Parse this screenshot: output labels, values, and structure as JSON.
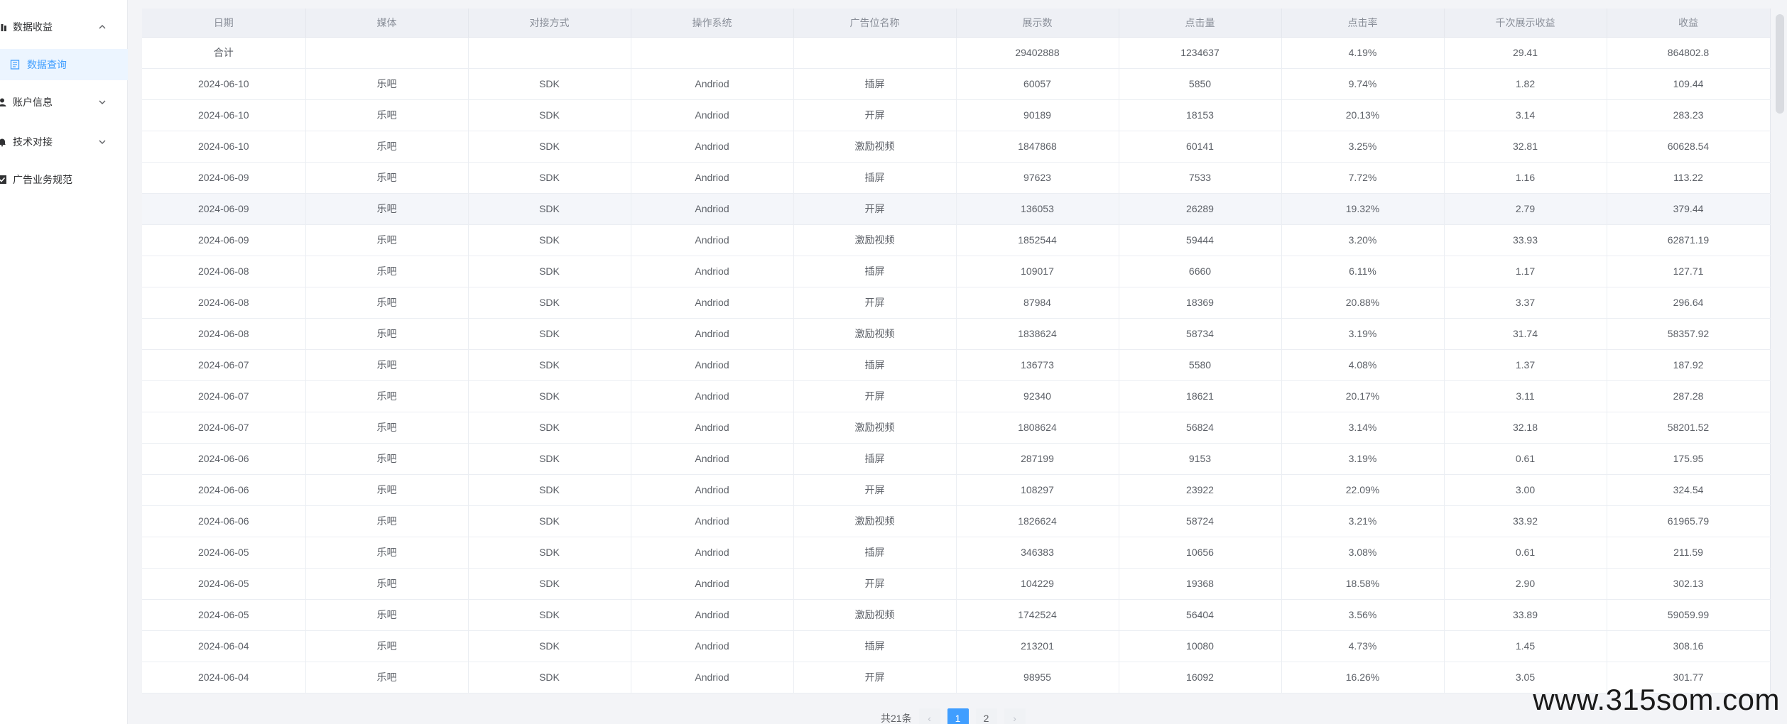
{
  "sidebar": {
    "groups": [
      {
        "label": "数据收益",
        "icon": "chart-icon",
        "expanded": true
      },
      {
        "label": "账户信息",
        "icon": "user-icon",
        "expanded": false
      },
      {
        "label": "技术对接",
        "icon": "bell-icon",
        "expanded": false
      },
      {
        "label": "广告业务规范",
        "icon": "check-square-icon"
      }
    ],
    "active_sub": {
      "label": "数据查询",
      "icon": "document-icon"
    }
  },
  "table": {
    "columns": [
      "日期",
      "媒体",
      "对接方式",
      "操作系统",
      "广告位名称",
      "展示数",
      "点击量",
      "点击率",
      "千次展示收益",
      "收益"
    ],
    "total": [
      "合计",
      "",
      "",
      "",
      "",
      "29402888",
      "1234637",
      "4.19%",
      "29.41",
      "864802.8"
    ],
    "rows": [
      [
        "2024-06-10",
        "乐吧",
        "SDK",
        "Andriod",
        "插屏",
        "60057",
        "5850",
        "9.74%",
        "1.82",
        "109.44"
      ],
      [
        "2024-06-10",
        "乐吧",
        "SDK",
        "Andriod",
        "开屏",
        "90189",
        "18153",
        "20.13%",
        "3.14",
        "283.23"
      ],
      [
        "2024-06-10",
        "乐吧",
        "SDK",
        "Andriod",
        "激励视频",
        "1847868",
        "60141",
        "3.25%",
        "32.81",
        "60628.54"
      ],
      [
        "2024-06-09",
        "乐吧",
        "SDK",
        "Andriod",
        "插屏",
        "97623",
        "7533",
        "7.72%",
        "1.16",
        "113.22"
      ],
      [
        "2024-06-09",
        "乐吧",
        "SDK",
        "Andriod",
        "开屏",
        "136053",
        "26289",
        "19.32%",
        "2.79",
        "379.44"
      ],
      [
        "2024-06-09",
        "乐吧",
        "SDK",
        "Andriod",
        "激励视频",
        "1852544",
        "59444",
        "3.20%",
        "33.93",
        "62871.19"
      ],
      [
        "2024-06-08",
        "乐吧",
        "SDK",
        "Andriod",
        "插屏",
        "109017",
        "6660",
        "6.11%",
        "1.17",
        "127.71"
      ],
      [
        "2024-06-08",
        "乐吧",
        "SDK",
        "Andriod",
        "开屏",
        "87984",
        "18369",
        "20.88%",
        "3.37",
        "296.64"
      ],
      [
        "2024-06-08",
        "乐吧",
        "SDK",
        "Andriod",
        "激励视频",
        "1838624",
        "58734",
        "3.19%",
        "31.74",
        "58357.92"
      ],
      [
        "2024-06-07",
        "乐吧",
        "SDK",
        "Andriod",
        "插屏",
        "136773",
        "5580",
        "4.08%",
        "1.37",
        "187.92"
      ],
      [
        "2024-06-07",
        "乐吧",
        "SDK",
        "Andriod",
        "开屏",
        "92340",
        "18621",
        "20.17%",
        "3.11",
        "287.28"
      ],
      [
        "2024-06-07",
        "乐吧",
        "SDK",
        "Andriod",
        "激励视频",
        "1808624",
        "56824",
        "3.14%",
        "32.18",
        "58201.52"
      ],
      [
        "2024-06-06",
        "乐吧",
        "SDK",
        "Andriod",
        "插屏",
        "287199",
        "9153",
        "3.19%",
        "0.61",
        "175.95"
      ],
      [
        "2024-06-06",
        "乐吧",
        "SDK",
        "Andriod",
        "开屏",
        "108297",
        "23922",
        "22.09%",
        "3.00",
        "324.54"
      ],
      [
        "2024-06-06",
        "乐吧",
        "SDK",
        "Andriod",
        "激励视频",
        "1826624",
        "58724",
        "3.21%",
        "33.92",
        "61965.79"
      ],
      [
        "2024-06-05",
        "乐吧",
        "SDK",
        "Andriod",
        "插屏",
        "346383",
        "10656",
        "3.08%",
        "0.61",
        "211.59"
      ],
      [
        "2024-06-05",
        "乐吧",
        "SDK",
        "Andriod",
        "开屏",
        "104229",
        "19368",
        "18.58%",
        "2.90",
        "302.13"
      ],
      [
        "2024-06-05",
        "乐吧",
        "SDK",
        "Andriod",
        "激励视频",
        "1742524",
        "56404",
        "3.56%",
        "33.89",
        "59059.99"
      ],
      [
        "2024-06-04",
        "乐吧",
        "SDK",
        "Andriod",
        "插屏",
        "213201",
        "10080",
        "4.73%",
        "1.45",
        "308.16"
      ],
      [
        "2024-06-04",
        "乐吧",
        "SDK",
        "Andriod",
        "开屏",
        "98955",
        "16092",
        "16.26%",
        "3.05",
        "301.77"
      ]
    ]
  },
  "pagination": {
    "total_label": "共21条",
    "prev": "‹",
    "next": "›",
    "pages": [
      "1",
      "2"
    ],
    "current": "1"
  },
  "watermark": "www.315som.com",
  "colors": {
    "accent": "#409eff",
    "header_bg": "#eef0f5",
    "active_nav_bg": "#ecf5ff"
  }
}
